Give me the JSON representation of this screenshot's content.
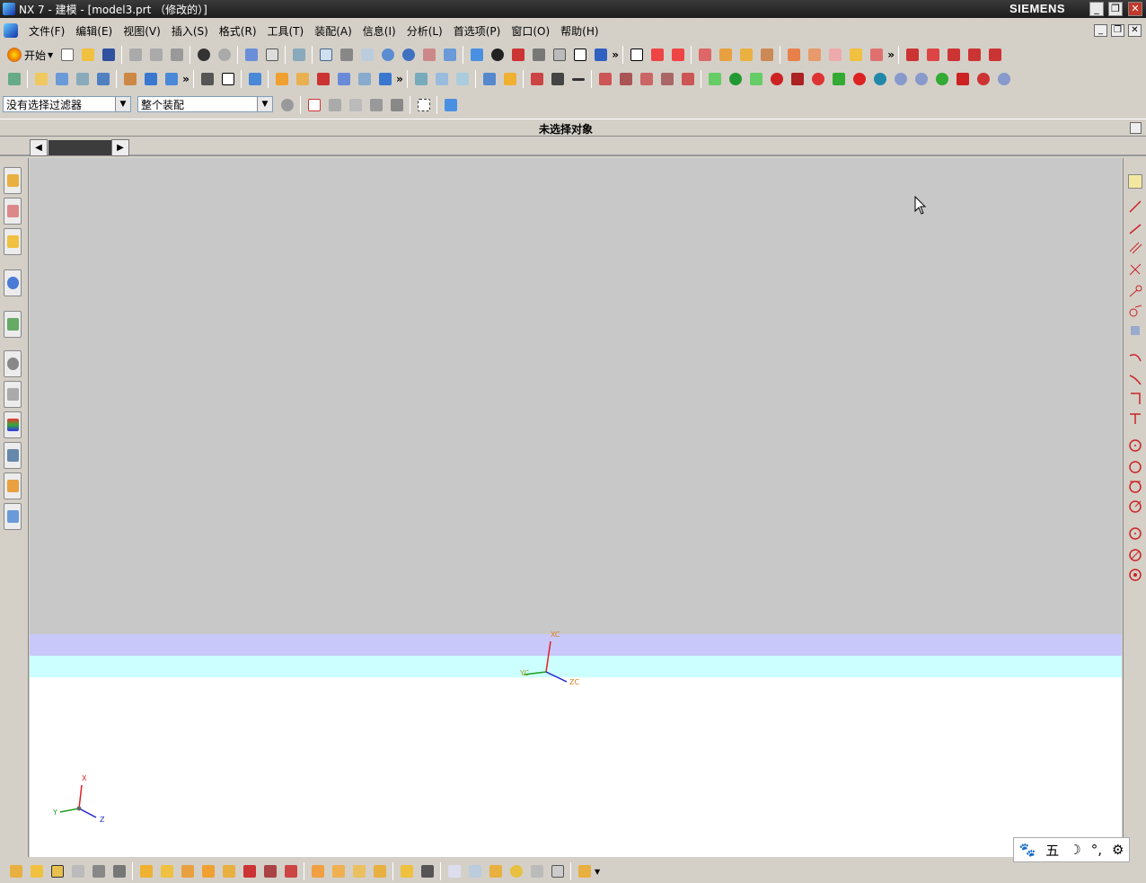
{
  "window": {
    "title": "NX 7 - 建模 - [model3.prt （修改的）]",
    "brand": "SIEMENS",
    "minimize": "_",
    "restore": "❐",
    "close": "✕"
  },
  "menu": {
    "items": [
      "文件(F)",
      "编辑(E)",
      "视图(V)",
      "插入(S)",
      "格式(R)",
      "工具(T)",
      "装配(A)",
      "信息(I)",
      "分析(L)",
      "首选项(P)",
      "窗口(O)",
      "帮助(H)"
    ]
  },
  "toolbar1": {
    "start_label": "开始"
  },
  "selection": {
    "filter_value": "没有选择过滤器",
    "scope_value": "整个装配"
  },
  "status": {
    "message": "未选择对象"
  },
  "viewport": {
    "wcs": {
      "x_label": "XC",
      "y_label": "YC",
      "z_label": "ZC"
    },
    "abs": {
      "x_label": "X",
      "y_label": "Y",
      "z_label": "Z"
    },
    "colors": {
      "background_top": "#c8c8c8",
      "band_lavender": "#c8c8fa",
      "band_cyan": "#ccffff",
      "background_bottom": "#ffffff",
      "axis_x": "#e02020",
      "axis_y": "#20a020",
      "axis_z": "#2020d0"
    }
  },
  "ime": {
    "mode_label": "五"
  }
}
